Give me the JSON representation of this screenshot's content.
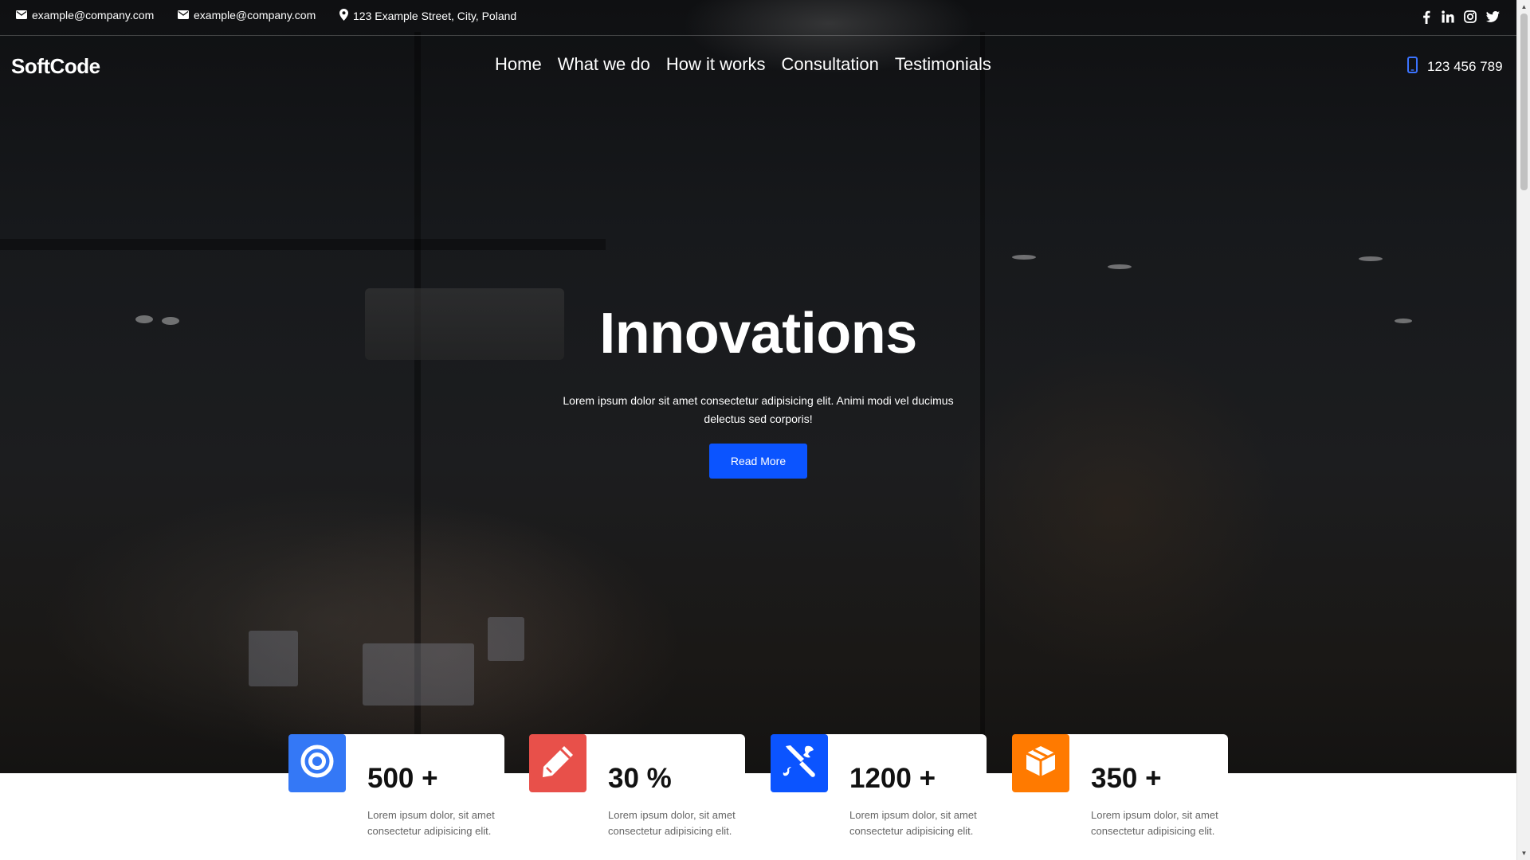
{
  "topbar": {
    "email_1": "example@company.com",
    "email_2": "example@company.com",
    "address": "123 Example Street, City, Poland",
    "socials": [
      "facebook-icon",
      "linkedin-icon",
      "instagram-icon",
      "twitter-icon"
    ]
  },
  "header": {
    "logo": "SoftCode",
    "nav": [
      "Home",
      "What we do",
      "How it works",
      "Consultation",
      "Testimonials"
    ],
    "phone": "123 456 789"
  },
  "hero": {
    "title": "Innovations",
    "subtitle": "Lorem ipsum dolor sit amet consectetur adipisicing elit. Animi modi vel ducimus delectus sed corporis!",
    "button": "Read More"
  },
  "stats": [
    {
      "icon": "target-icon",
      "color": "#3478f6",
      "value": "500 +",
      "desc": "Lorem ipsum dolor, sit amet consectetur adipisicing elit."
    },
    {
      "icon": "pencil-icon",
      "color": "#e8504a",
      "value": "30 %",
      "desc": "Lorem ipsum dolor, sit amet consectetur adipisicing elit."
    },
    {
      "icon": "tools-icon",
      "color": "#0b54ff",
      "value": "1200 +",
      "desc": "Lorem ipsum dolor, sit amet consectetur adipisicing elit."
    },
    {
      "icon": "box-icon",
      "color": "#ff7a00",
      "value": "350 +",
      "desc": "Lorem ipsum dolor, sit amet consectetur adipisicing elit."
    }
  ],
  "colors": {
    "accent": "#0b54ff",
    "phone_icon": "#3b73ff"
  }
}
